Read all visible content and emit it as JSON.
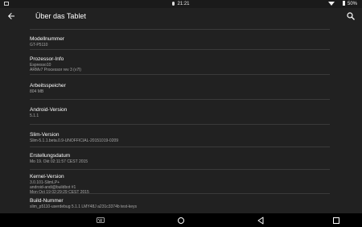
{
  "status": {
    "time": "21:21",
    "battery": "50%"
  },
  "toolbar": {
    "title": "Über das Tablet"
  },
  "items": [
    {
      "title": "Modellnummer",
      "value": "GT-P5110"
    },
    {
      "title": "Prozessor-Info",
      "value": "Espresso10\nARMv7 Processor rev 3 (v7l)"
    },
    {
      "title": "Arbeitsspeicher",
      "value": "804 MB"
    },
    {
      "title": "Android-Version",
      "value": "5.1.1"
    },
    {
      "title": "Slim-Version",
      "value": "Slim-5.1.1.beta.0.9-UNOFFICIAL-20151019-0209"
    },
    {
      "title": "Erstellungsdatum",
      "value": "Mo 19. Okt 02:11:57 CEST 2015"
    },
    {
      "title": "Kernel-Version",
      "value": "3.0.101-SlimLP+\nandroid-andi@buildbot #1\nMon Oct 19 02:29:29 CEST 2015"
    },
    {
      "title": "Build-Nummer",
      "value": "slim_p5110-userdebug 5.1.1 LMY48J a231c3374b test-keys"
    }
  ],
  "icons": {
    "back": "arrow-back-icon",
    "search": "search-icon",
    "nav_back": "triangle-back-icon",
    "nav_home": "circle-home-icon",
    "nav_recents": "square-recents-icon"
  }
}
